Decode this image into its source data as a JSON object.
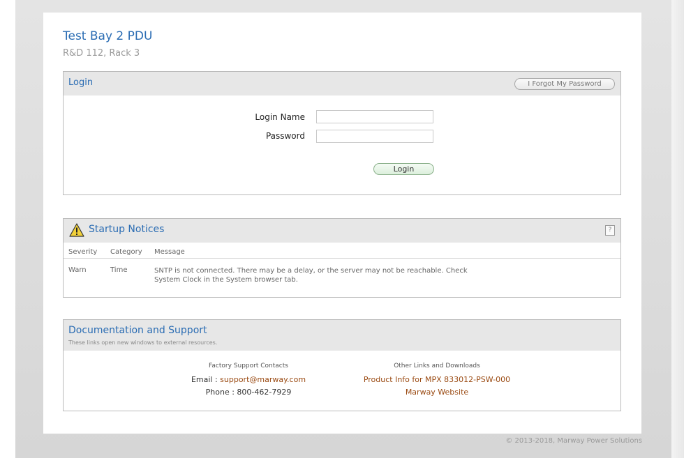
{
  "site": {
    "title": "Test Bay 2 PDU",
    "subtitle": "R&D 112, Rack 3"
  },
  "login": {
    "panel_title": "Login",
    "forgot_label": "I Forgot My Password",
    "name_label": "Login Name",
    "password_label": "Password",
    "name_value": "",
    "password_value": "",
    "submit_label": "Login"
  },
  "notices": {
    "panel_title": "Startup Notices",
    "help_label": "?",
    "icon": "warning-triangle-icon",
    "columns": [
      "Severity",
      "Category",
      "Message"
    ],
    "rows": [
      {
        "severity": "Warn",
        "category": "Time",
        "message": "SNTP is not connected. There may be a delay, or the server may not be reachable. Check System Clock in the System browser tab."
      }
    ]
  },
  "docs": {
    "panel_title": "Documentation and Support",
    "subtitle": "These links open new windows to external resources.",
    "support": {
      "heading": "Factory Support Contacts",
      "email_label": "Email : ",
      "email": "support@marway.com",
      "phone_label": "Phone : ",
      "phone": "800-462-7929"
    },
    "links": {
      "heading": "Other Links and Downloads",
      "product_info": "Product Info for MPX 833012-PSW-000",
      "website": "Marway Website"
    }
  },
  "footer": {
    "copyright": "© 2013-2018, Marway Power Solutions"
  },
  "colors": {
    "accent": "#2a6cb3",
    "link": "#9a4a12",
    "panel_header": "#e7e7e7",
    "border": "#b9b9b9",
    "warning": "#f2d13a"
  }
}
